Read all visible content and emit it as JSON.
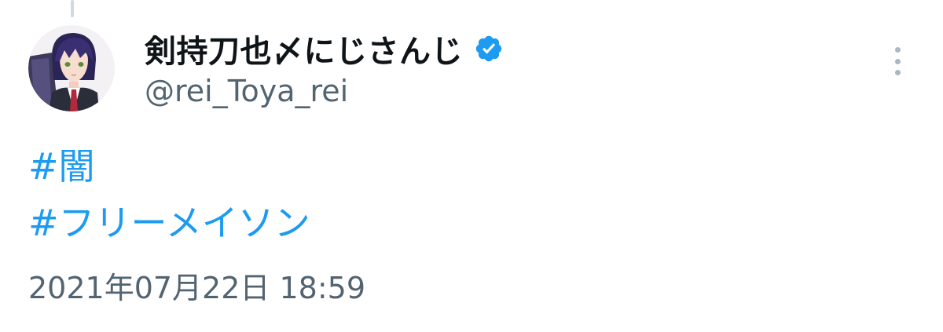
{
  "tweet": {
    "author": {
      "display_name": "剣持刀也〆にじさんじ",
      "handle": "@rei_Toya_rei",
      "verified": true
    },
    "hashtags": [
      "#闇",
      "#フリーメイソン"
    ],
    "timestamp": "2021年07月22日 18:59"
  },
  "icons": {
    "avatar": "anime-avatar",
    "verified": "verified-badge-icon",
    "more": "more-options-icon"
  },
  "colors": {
    "link": "#1d9bf0",
    "verified": "#1d9bf0",
    "text_primary": "#0f1419",
    "text_secondary": "#536471",
    "thread_line": "#cfd9de"
  }
}
